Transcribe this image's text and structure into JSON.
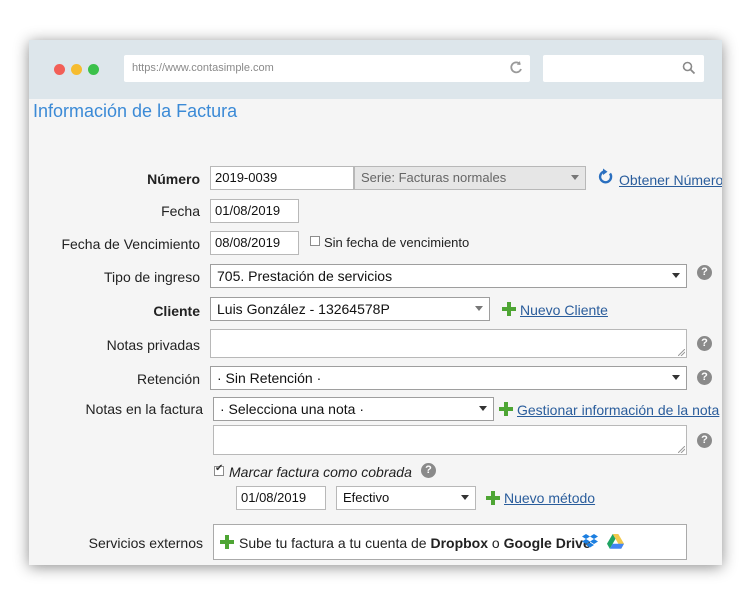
{
  "browser": {
    "url": "https://www.contasimple.com",
    "search_placeholder": ""
  },
  "page": {
    "title": "Información de la Factura"
  },
  "form": {
    "numero": {
      "label": "Número",
      "value": "2019-0039",
      "serie": "Serie: Facturas normales",
      "link": "Obtener Número"
    },
    "fecha": {
      "label": "Fecha",
      "value": "01/08/2019"
    },
    "vencimiento": {
      "label": "Fecha de Vencimiento",
      "value": "08/08/2019",
      "checkbox_label": "Sin fecha de vencimiento"
    },
    "tipo_ingreso": {
      "label": "Tipo de ingreso",
      "value": "705. Prestación de servicios"
    },
    "cliente": {
      "label": "Cliente",
      "value": "Luis González - 13264578P",
      "link": "Nuevo Cliente"
    },
    "notas_privadas": {
      "label": "Notas privadas",
      "value": ""
    },
    "retencion": {
      "label": "Retención",
      "value": "· Sin Retención ·"
    },
    "notas_factura": {
      "label": "Notas en la factura",
      "value": "· Selecciona una nota ·",
      "link": "Gestionar información de la nota"
    },
    "cobrada": {
      "label": "Marcar factura como cobrada",
      "checked": true,
      "date": "01/08/2019",
      "method": "Efectivo",
      "link": "Nuevo método"
    },
    "servicios": {
      "label": "Servicios externos",
      "msg_pre": "Sube tu factura a tu cuenta de ",
      "dropbox": "Dropbox",
      "msg_mid": " o ",
      "gdrive": "Google Drive"
    },
    "help_glyph": "?"
  },
  "colors": {
    "accent": "#3b8ad6",
    "link": "#2a5d9c",
    "plus": "#4ea534"
  }
}
